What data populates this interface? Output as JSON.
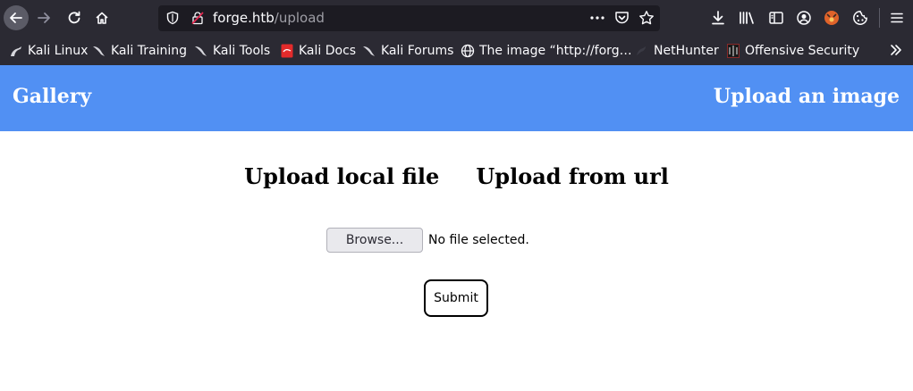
{
  "browser": {
    "url_host": "forge.htb",
    "url_path": "/upload",
    "bookmarks": [
      {
        "label": "Kali Linux",
        "icon": "kali-dragon-icon"
      },
      {
        "label": "Kali Training",
        "icon": "kali-dragon-icon"
      },
      {
        "label": "Kali Tools",
        "icon": "kali-dragon-icon"
      },
      {
        "label": "Kali Docs",
        "icon": "kali-docs-icon"
      },
      {
        "label": "Kali Forums",
        "icon": "kali-dragon-icon"
      },
      {
        "label": "The image “http://forg…",
        "icon": "globe-icon"
      },
      {
        "label": "NetHunter",
        "icon": "nethunter-icon"
      },
      {
        "label": "Offensive Security",
        "icon": "offsec-icon"
      }
    ]
  },
  "header": {
    "logo": "Gallery",
    "upload_link": "Upload an image",
    "color": "#5190f3"
  },
  "main": {
    "tabs": [
      "Upload local file",
      "Upload from url"
    ],
    "browse_label": "Browse...",
    "file_status": "No file selected.",
    "submit_label": "Submit"
  }
}
